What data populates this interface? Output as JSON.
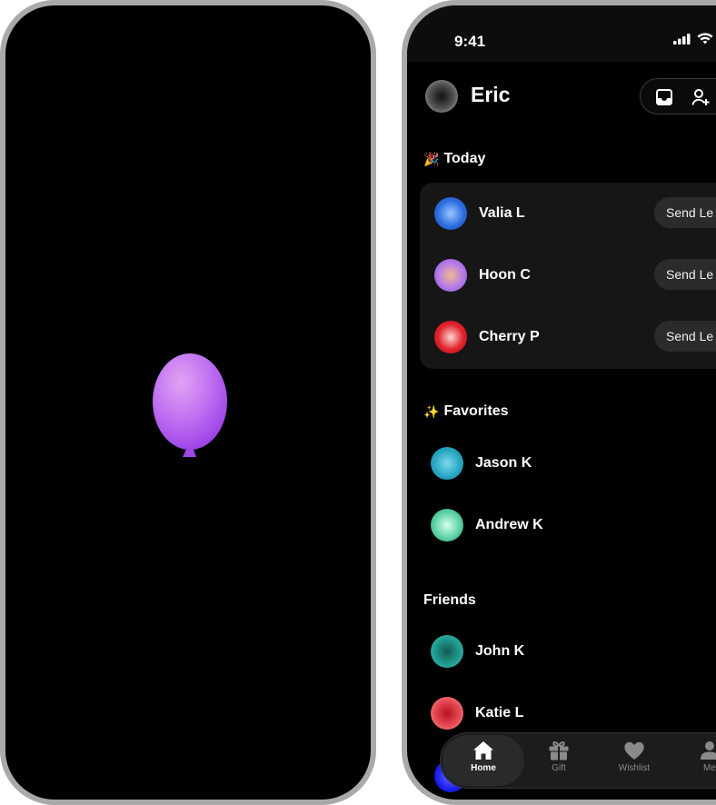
{
  "status_bar": {
    "time": "9:41"
  },
  "header": {
    "user_name": "Eric"
  },
  "sections": {
    "today": {
      "emoji": "🎉",
      "title": "Today"
    },
    "favorites": {
      "emoji": "✨",
      "title": "Favorites"
    },
    "friends": {
      "title": "Friends"
    }
  },
  "today_items": [
    {
      "name": "Valia L",
      "action": "Send Le"
    },
    {
      "name": "Hoon C",
      "action": "Send Le"
    },
    {
      "name": "Cherry P",
      "action": "Send Le"
    }
  ],
  "favorites_items": [
    {
      "name": "Jason K"
    },
    {
      "name": "Andrew K"
    }
  ],
  "friends_items": [
    {
      "name": "John K"
    },
    {
      "name": "Katie L"
    }
  ],
  "tabs": [
    {
      "label": "Home",
      "icon": "home-icon",
      "active": true
    },
    {
      "label": "Gift",
      "icon": "gift-icon"
    },
    {
      "label": "Wishlist",
      "icon": "heart-icon"
    },
    {
      "label": "Me",
      "icon": "person-icon"
    }
  ],
  "colors": {
    "balloon": "#b060ee",
    "avatar_valia": "#2e6fe0",
    "avatar_hoon": "#a067f0",
    "avatar_cherry": "#e0222b",
    "avatar_jason": "#2aa8c4",
    "avatar_andrew": "#37c08f",
    "avatar_john": "#22a194",
    "avatar_katie": "#e64b55"
  }
}
